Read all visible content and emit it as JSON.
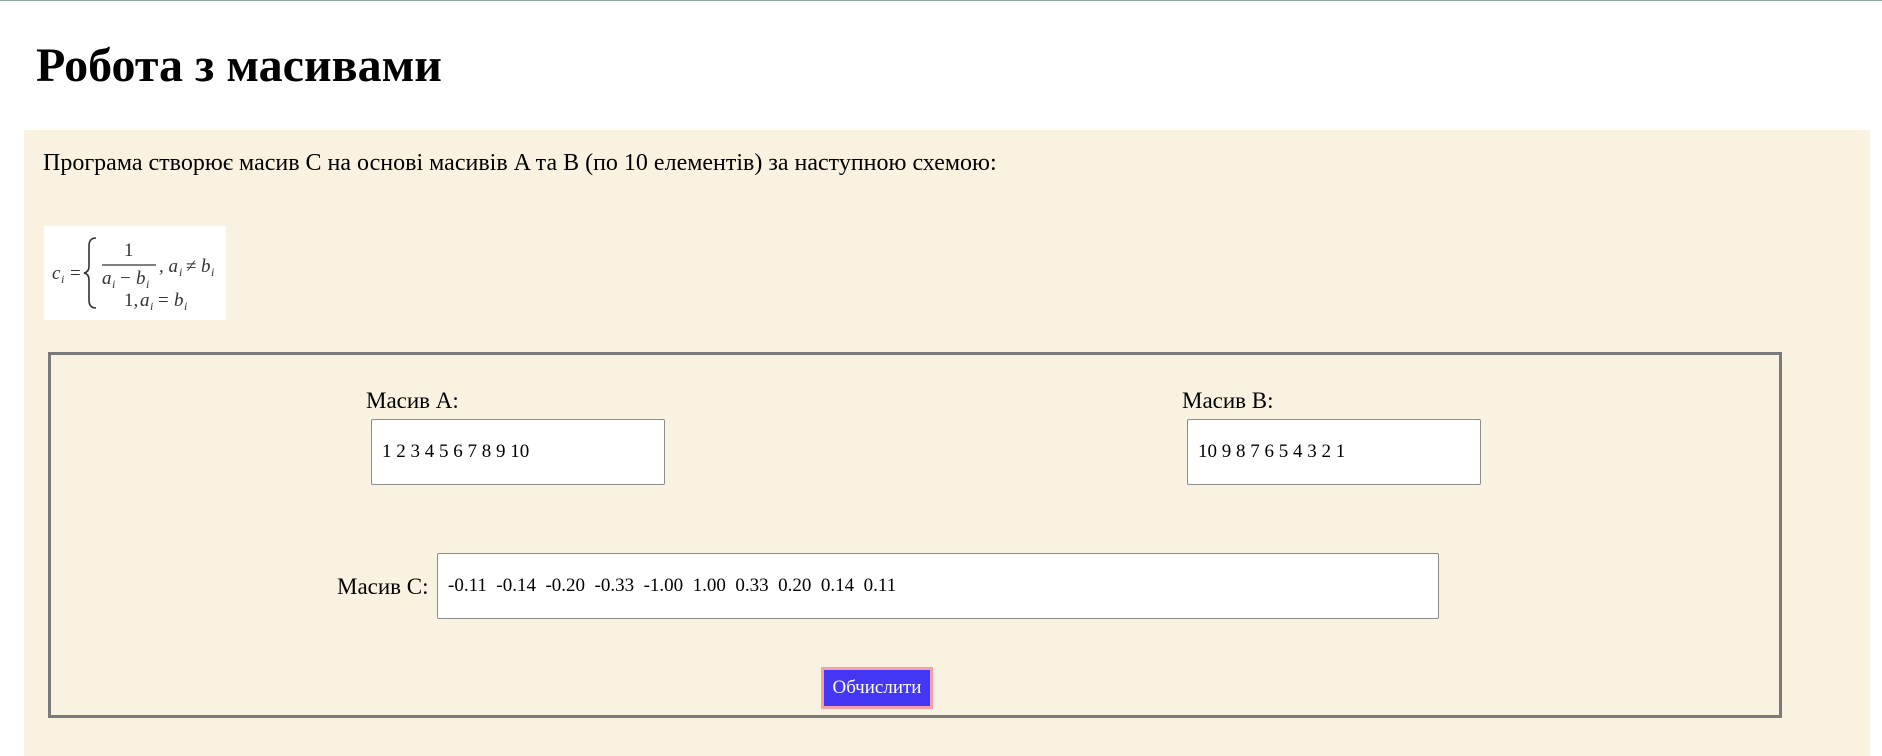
{
  "page": {
    "title": "Робота з масивами",
    "intro": "Програма створює масив C на основі масивів A та B (по 10 елементів) за наступною схемою:"
  },
  "formula": {
    "lhs": "c",
    "index": "i",
    "fraction_numerator": "1",
    "fraction_denominator": "a − b",
    "case1_condition": ", a ≠ b",
    "case2_value": "1, a = b"
  },
  "form": {
    "array_a_label": "Масив A:",
    "array_a_value": "1 2 3 4 5 6 7 8 9 10",
    "array_b_label": "Масив B:",
    "array_b_value": "10 9 8 7 6 5 4 3 2 1",
    "array_c_label": "Масив C:",
    "array_c_value": "-0.11  -0.14  -0.20  -0.33  -1.00  1.00  0.33  0.20  0.14  0.11",
    "compute_button": "Обчислити"
  },
  "colors": {
    "panel_background": "#faf2e1",
    "button_background": "#4437f4",
    "button_border": "#f4a0a8"
  }
}
